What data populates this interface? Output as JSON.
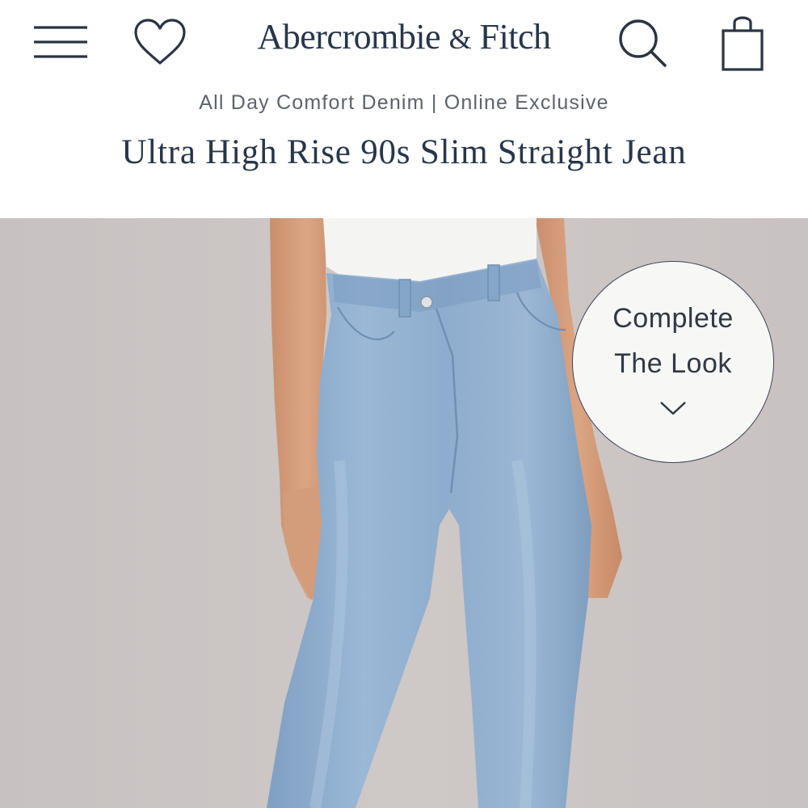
{
  "header": {
    "logo_main": "Abercrombie",
    "logo_amp": "&",
    "logo_end": "Fitch",
    "menu_icon": "hamburger-menu-icon",
    "favorites_icon": "heart-icon",
    "search_icon": "search-icon",
    "bag_icon": "shopping-bag-icon"
  },
  "product": {
    "collection": "All Day Comfort Denim | Online Exclusive",
    "name": "Ultra High Rise 90s Slim Straight Jean"
  },
  "complete_the_look": {
    "line1": "Complete",
    "line2": "The Look",
    "icon": "chevron-down-icon"
  },
  "colors": {
    "brand_navy": "#27364a",
    "subtitle_gray": "#5d636a",
    "image_background": "#cbc4c3",
    "denim": "#8fb0d2",
    "top_white": "#f4f4f2"
  }
}
